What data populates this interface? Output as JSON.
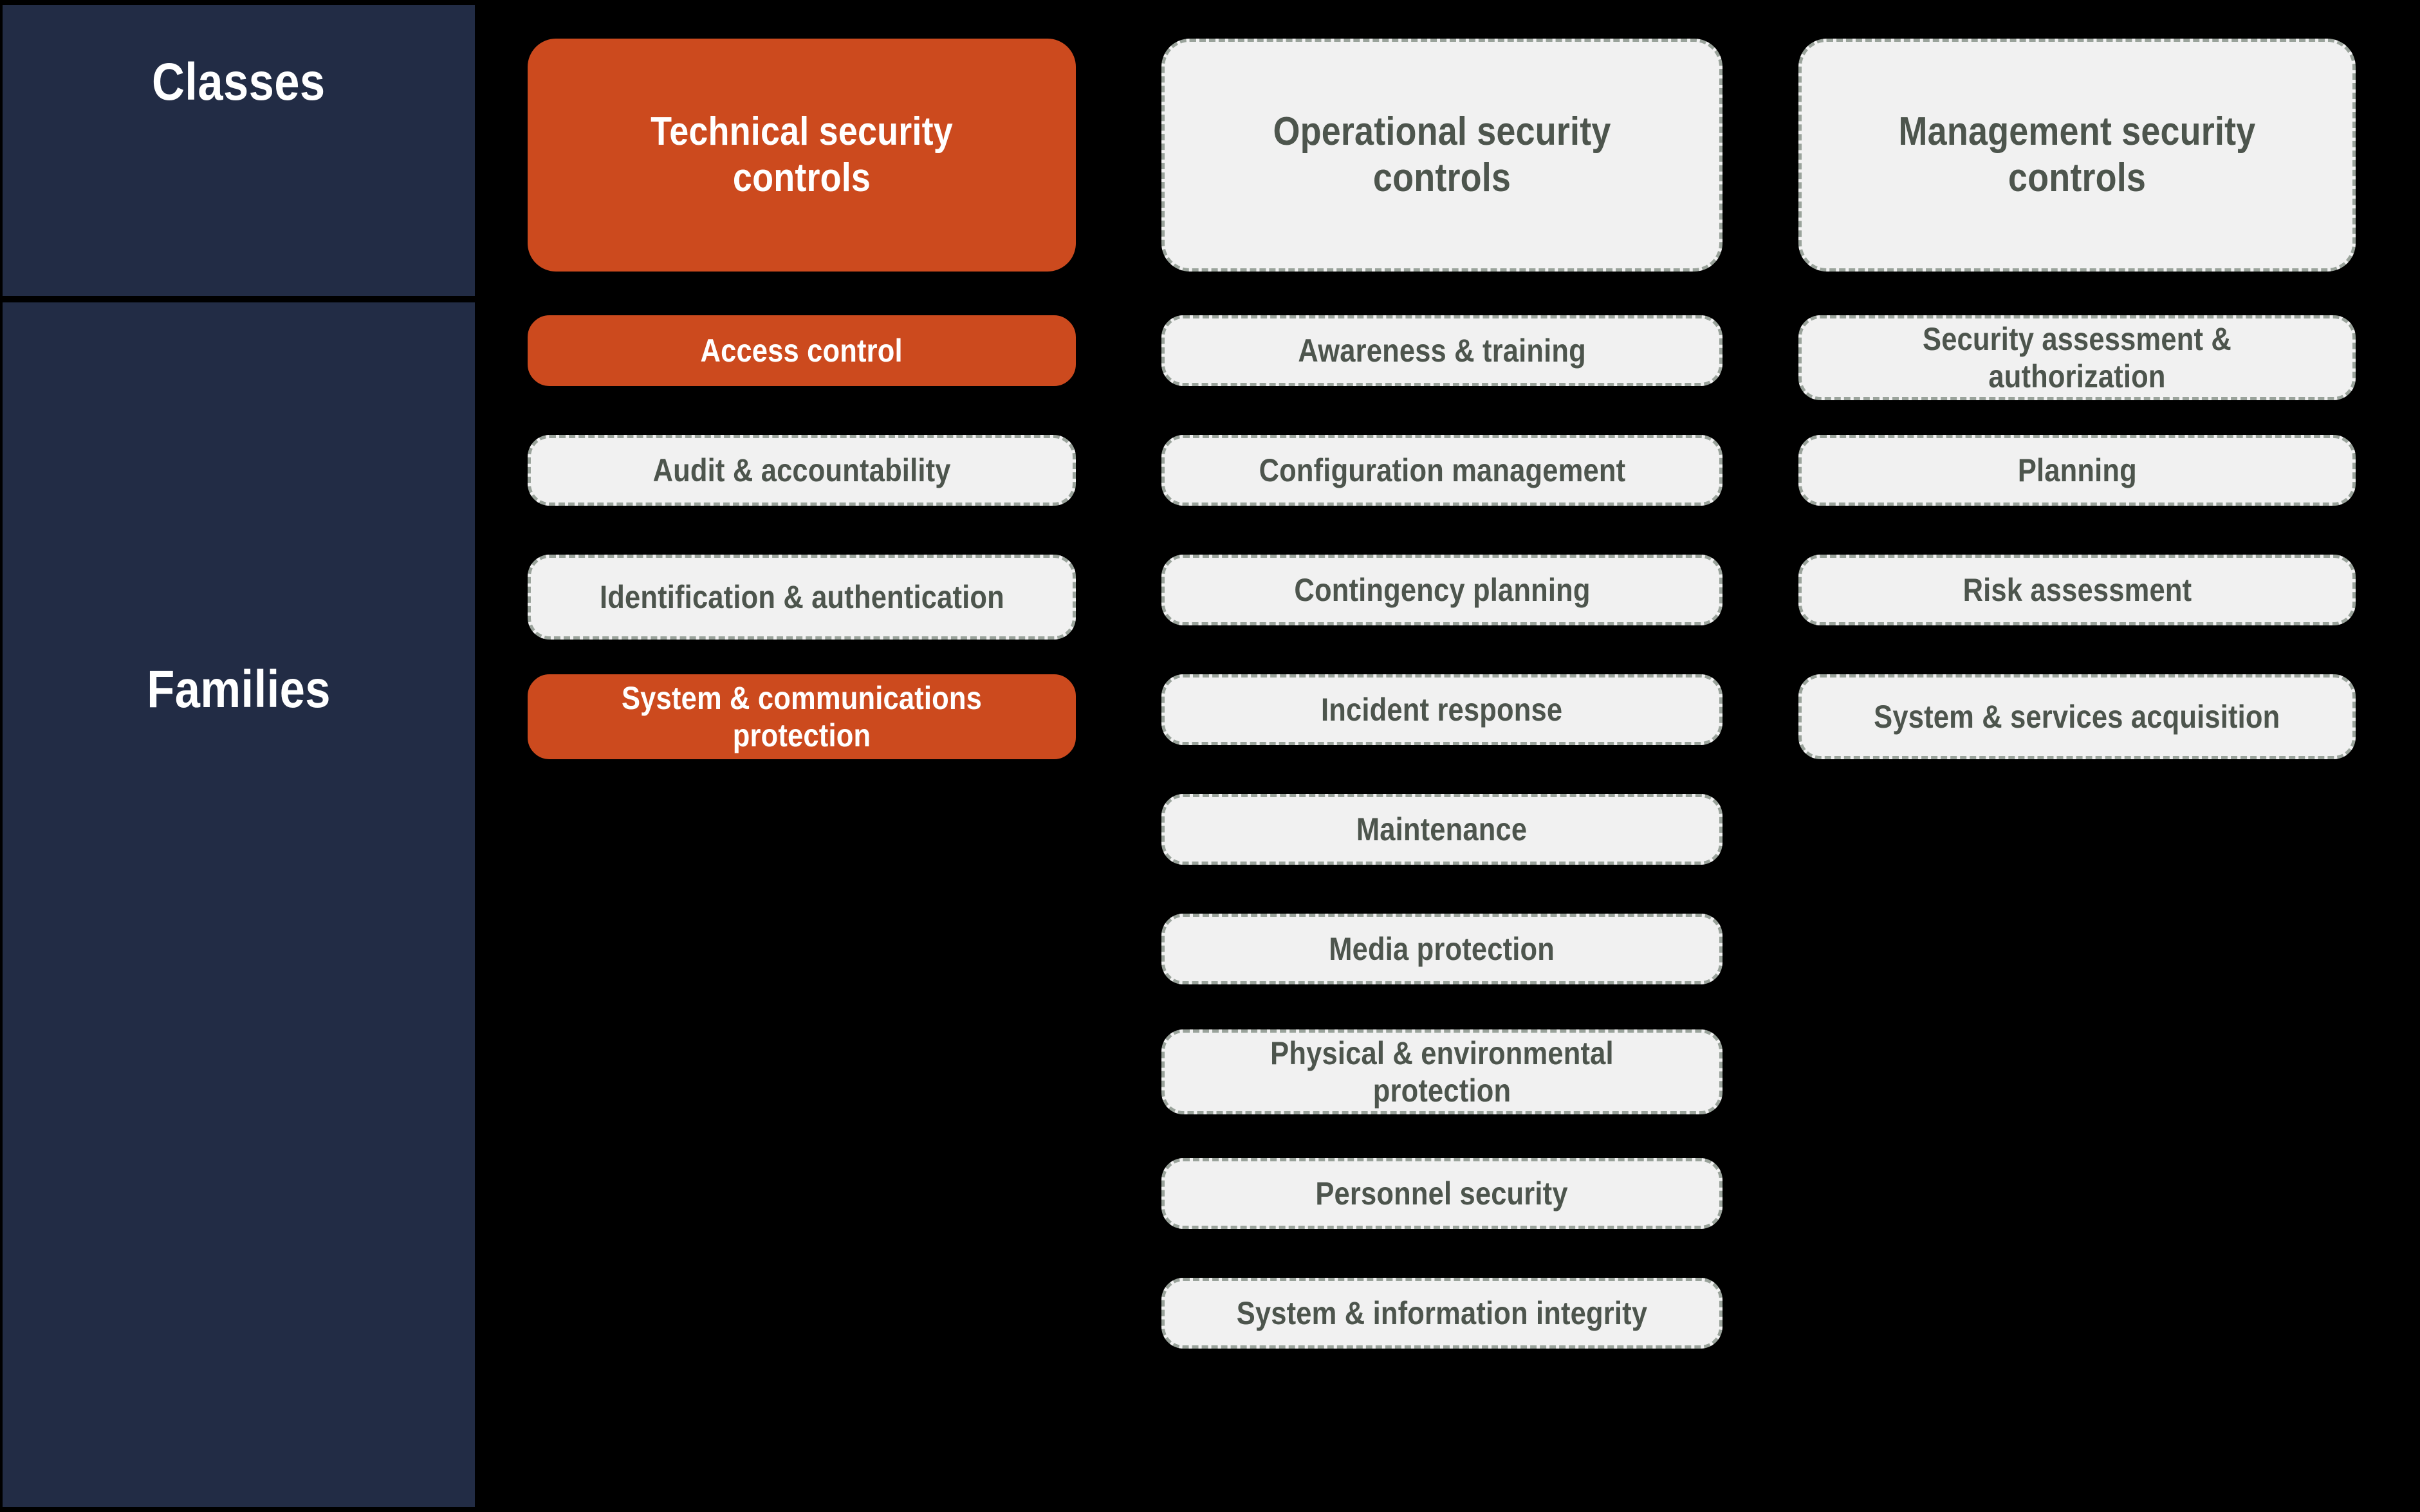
{
  "colors": {
    "background": "#000000",
    "sidebar": "#222c45",
    "accent": "#cc4a1e",
    "muted_fill": "#f1f1f1",
    "muted_border": "#9aa39b",
    "muted_text": "#4d554d",
    "accent_text": "#ffffff"
  },
  "sidebar": {
    "rows": [
      {
        "label": "Classes"
      },
      {
        "label": "Families"
      }
    ]
  },
  "columns": [
    {
      "key": "technical",
      "header": {
        "label": "Technical security controls",
        "style": "accent"
      },
      "families": [
        {
          "label": "Access control",
          "style": "accent"
        },
        {
          "label": "Audit & accountability",
          "style": "muted"
        },
        {
          "label": "Identification & authentication",
          "style": "muted"
        },
        {
          "label": "System & communications protection",
          "style": "accent"
        }
      ]
    },
    {
      "key": "operational",
      "header": {
        "label": "Operational security controls",
        "style": "muted"
      },
      "families": [
        {
          "label": "Awareness & training",
          "style": "muted"
        },
        {
          "label": "Configuration management",
          "style": "muted"
        },
        {
          "label": "Contingency planning",
          "style": "muted"
        },
        {
          "label": "Incident response",
          "style": "muted"
        },
        {
          "label": "Maintenance",
          "style": "muted"
        },
        {
          "label": "Media protection",
          "style": "muted"
        },
        {
          "label": "Physical & environmental protection",
          "style": "muted"
        },
        {
          "label": "Personnel security",
          "style": "muted"
        },
        {
          "label": "System & information integrity",
          "style": "muted"
        }
      ]
    },
    {
      "key": "management",
      "header": {
        "label": "Management security controls",
        "style": "muted"
      },
      "families": [
        {
          "label": "Security assessment & authorization",
          "style": "muted"
        },
        {
          "label": "Planning",
          "style": "muted"
        },
        {
          "label": "Risk assessment",
          "style": "muted"
        },
        {
          "label": "System & services acquisition",
          "style": "muted"
        }
      ]
    }
  ]
}
